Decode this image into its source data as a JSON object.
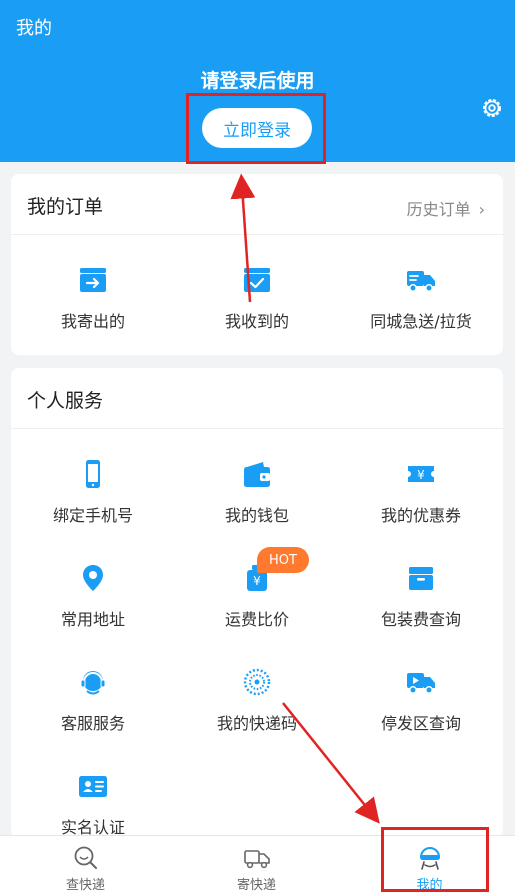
{
  "header": {
    "title": "我的",
    "login_hint": "请登录后使用",
    "login_button": "立即登录",
    "settings_icon": "gear-icon"
  },
  "orders": {
    "title": "我的订单",
    "history_link": "历史订单",
    "items": [
      {
        "label": "我寄出的",
        "icon": "send-box-icon"
      },
      {
        "label": "我收到的",
        "icon": "received-box-icon"
      },
      {
        "label": "同城急送/拉货",
        "icon": "delivery-truck-icon"
      }
    ]
  },
  "services": {
    "title": "个人服务",
    "items": [
      {
        "label": "绑定手机号",
        "icon": "phone-icon"
      },
      {
        "label": "我的钱包",
        "icon": "wallet-icon"
      },
      {
        "label": "我的优惠券",
        "icon": "coupon-icon"
      },
      {
        "label": "常用地址",
        "icon": "location-pin-icon"
      },
      {
        "label": "运费比价",
        "icon": "price-bag-icon",
        "badge": "HOT"
      },
      {
        "label": "包装费查询",
        "icon": "package-box-icon"
      },
      {
        "label": "客服服务",
        "icon": "headset-icon"
      },
      {
        "label": "我的快递码",
        "icon": "qr-code-icon"
      },
      {
        "label": "停发区查询",
        "icon": "stop-truck-icon"
      },
      {
        "label": "实名认证",
        "icon": "id-card-icon"
      }
    ]
  },
  "tabbar": {
    "items": [
      {
        "label": "查快递",
        "icon": "search-icon",
        "active": false
      },
      {
        "label": "寄快递",
        "icon": "truck-icon",
        "active": false
      },
      {
        "label": "我的",
        "icon": "profile-icon",
        "active": true
      }
    ]
  },
  "colors": {
    "primary": "#1a9ef5",
    "hot_badge": "#ff7a2e",
    "annotation": "#e02424"
  }
}
